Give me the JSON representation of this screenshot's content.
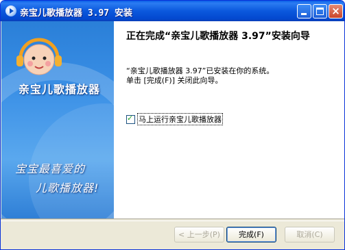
{
  "window": {
    "title": "亲宝儿歌播放器 3.97 安装"
  },
  "left_panel": {
    "brand": "亲宝儿歌播放器",
    "slogan_line1": "宝宝最喜爱的",
    "slogan_line2": "儿歌播放器!"
  },
  "content": {
    "heading": "正在完成“亲宝儿歌播放器 3.97”安装向导",
    "desc_line1": "“亲宝儿歌播放器 3.97”已安装在你的系统。",
    "desc_line2": "单击 [完成(F)] 关闭此向导。",
    "checkbox_label": "马上运行亲宝儿歌播放器",
    "checkbox_checked": true
  },
  "buttons": {
    "back": "< 上一步(P)",
    "finish": "完成(F)",
    "cancel": "取消(C)"
  },
  "colors": {
    "titlebar": "#0a5fe8",
    "panel_blue": "#3b90e6"
  }
}
